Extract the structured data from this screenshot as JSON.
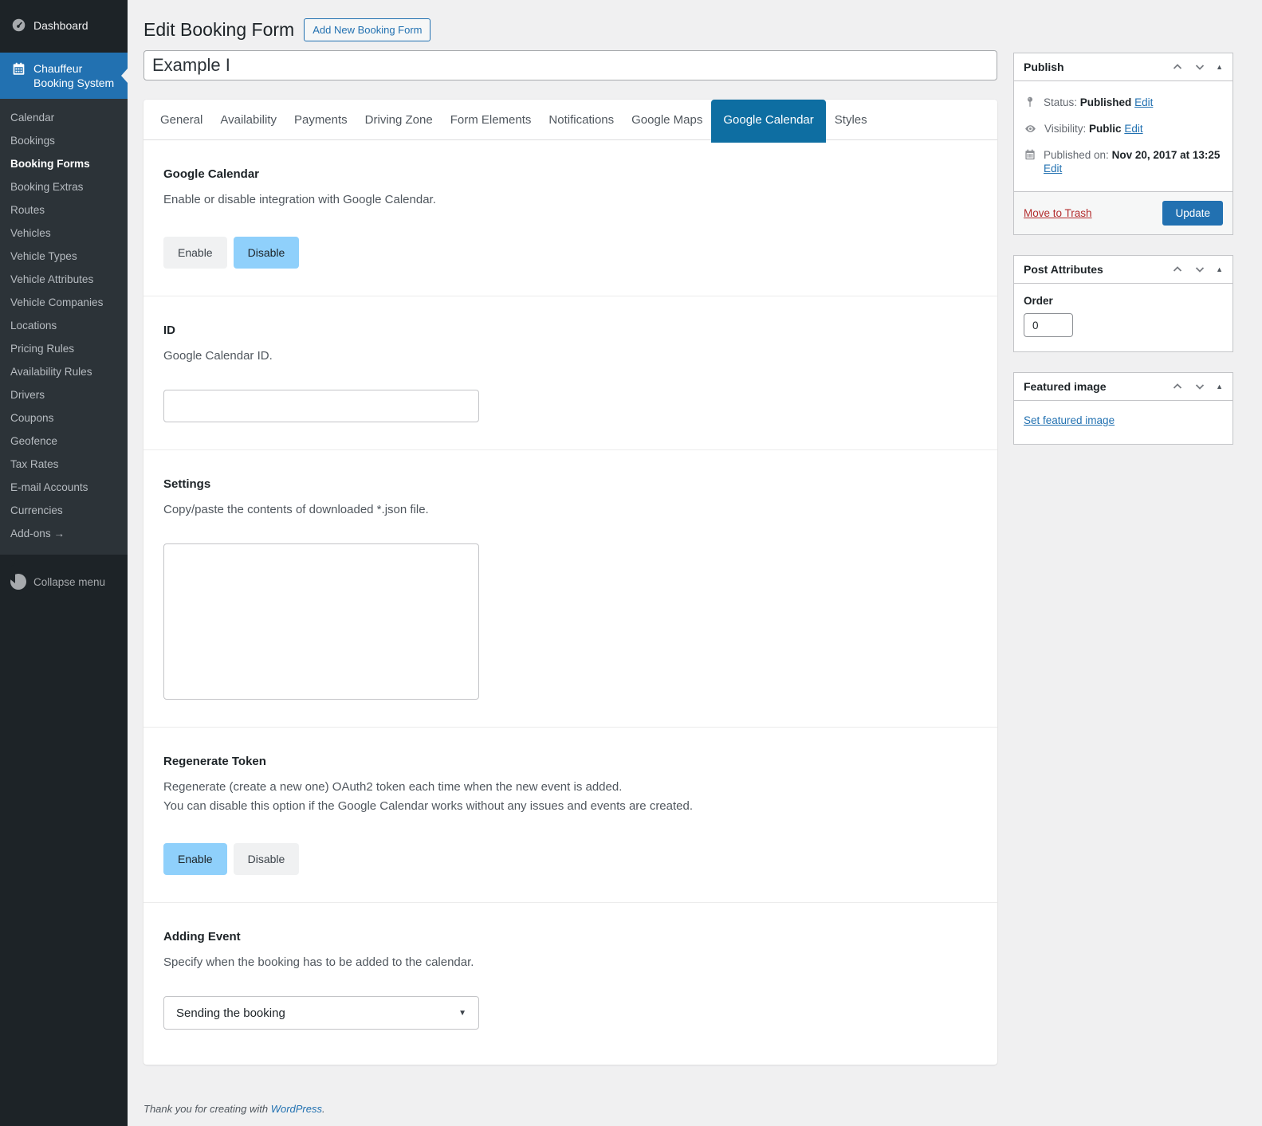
{
  "sidebar": {
    "dashboard": "Dashboard",
    "plugin_line1": "Chauffeur",
    "plugin_line2": "Booking System",
    "submenu": [
      "Calendar",
      "Bookings",
      "Booking Forms",
      "Booking Extras",
      "Routes",
      "Vehicles",
      "Vehicle Types",
      "Vehicle Attributes",
      "Vehicle Companies",
      "Locations",
      "Pricing Rules",
      "Availability Rules",
      "Drivers",
      "Coupons",
      "Geofence",
      "Tax Rates",
      "E-mail Accounts",
      "Currencies",
      "Add-ons →"
    ],
    "active_submenu": "Booking Forms",
    "collapse": "Collapse menu"
  },
  "header": {
    "title": "Edit Booking Form",
    "add_new_label": "Add New Booking Form"
  },
  "title_field": {
    "value": "Example I"
  },
  "tabs": {
    "items": [
      "General",
      "Availability",
      "Payments",
      "Driving Zone",
      "Form Elements",
      "Notifications",
      "Google Maps",
      "Google Calendar",
      "Styles"
    ],
    "active": "Google Calendar"
  },
  "sections": {
    "google_calendar": {
      "heading": "Google Calendar",
      "desc": "Enable or disable integration with Google Calendar.",
      "enable_label": "Enable",
      "disable_label": "Disable",
      "selected": "Disable"
    },
    "id": {
      "heading": "ID",
      "desc": "Google Calendar ID.",
      "value": ""
    },
    "settings": {
      "heading": "Settings",
      "desc": "Copy/paste the contents of downloaded *.json file.",
      "value": ""
    },
    "regenerate_token": {
      "heading": "Regenerate Token",
      "desc_line1": "Regenerate (create a new one) OAuth2 token each time when the new event is added.",
      "desc_line2": "You can disable this option if the Google Calendar works without any issues and events are created.",
      "enable_label": "Enable",
      "disable_label": "Disable",
      "selected": "Enable"
    },
    "adding_event": {
      "heading": "Adding Event",
      "desc": "Specify when the booking has to be added to the calendar.",
      "selected_option": "Sending the booking"
    }
  },
  "publish_box": {
    "title": "Publish",
    "status_label": "Status:",
    "status_value": "Published",
    "status_edit": "Edit",
    "visibility_label": "Visibility:",
    "visibility_value": "Public",
    "visibility_edit": "Edit",
    "published_label": "Published on:",
    "published_value": "Nov 20, 2017 at 13:25",
    "published_edit": "Edit",
    "move_to_trash": "Move to Trash",
    "update_label": "Update"
  },
  "post_attributes_box": {
    "title": "Post Attributes",
    "order_label": "Order",
    "order_value": "0"
  },
  "featured_image_box": {
    "title": "Featured image",
    "set_link": "Set featured image"
  },
  "footer": {
    "text_before": "Thank you for creating with ",
    "link": "WordPress",
    "text_after": "."
  },
  "icons": {
    "select_caret": "▼",
    "box_toggle": "▲"
  },
  "colors": {
    "accent": "#2271b1",
    "active_tab_bg": "#0e6ea2",
    "active_toggle_bg": "#8fd0fb",
    "trash_link": "#b32d2e",
    "sidebar_bg": "#1d2327",
    "submenu_bg": "#2c3338",
    "page_bg": "#f0f0f1"
  }
}
